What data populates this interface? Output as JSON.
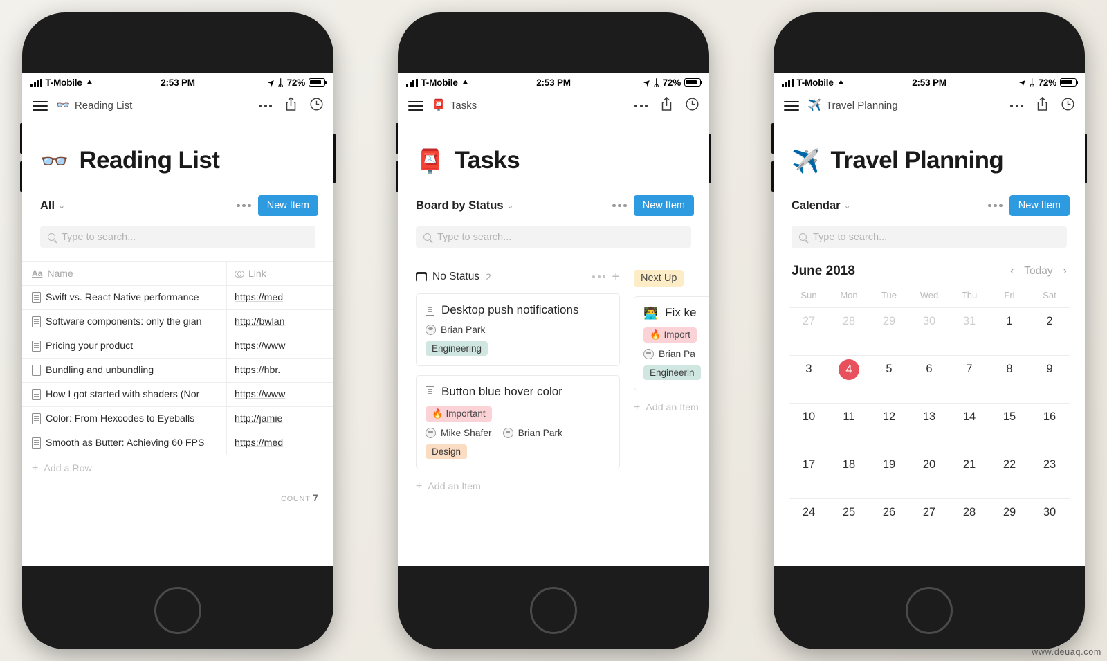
{
  "statusbar": {
    "carrier": "T-Mobile",
    "wifi_icon": "wifi-icon",
    "time": "2:53 PM",
    "location_icon": "location-arrow-icon",
    "bluetooth_icon": "bluetooth-icon",
    "battery": "72%"
  },
  "common": {
    "search_placeholder": "Type to search...",
    "new_item_label": "New Item",
    "menu_icon": "hamburger-menu-icon",
    "more_icon": "ellipsis-icon",
    "share_icon": "share-icon",
    "history_icon": "clock-history-icon",
    "accent_blue": "#2e9ae0",
    "accent_red": "#e8505b"
  },
  "phones": [
    {
      "nav": {
        "emoji": "👓",
        "title": "Reading List"
      },
      "page": {
        "emoji": "👓",
        "title": "Reading List"
      },
      "view": {
        "name": "All",
        "chevron": "⌄"
      },
      "table": {
        "columns": [
          {
            "label": "Name",
            "icon": "aa-text-icon"
          },
          {
            "label": "Link",
            "icon": "link-icon"
          }
        ],
        "rows": [
          {
            "name": "Swift vs. React Native performance",
            "link": "https://med"
          },
          {
            "name": "Software components: only the gian",
            "link": "http://bwlan"
          },
          {
            "name": "Pricing your product",
            "link": "https://www"
          },
          {
            "name": "Bundling and unbundling",
            "link": "https://hbr."
          },
          {
            "name": "How I got started with shaders (Nor",
            "link": "https://www"
          },
          {
            "name": "Color: From Hexcodes to Eyeballs",
            "link": "http://jamie"
          },
          {
            "name": "Smooth as Butter: Achieving 60 FPS",
            "link": "https://med"
          }
        ],
        "add_row_label": "Add a Row",
        "count_label": "COUNT",
        "count_value": "7"
      }
    },
    {
      "nav": {
        "emoji": "📮",
        "title": "Tasks"
      },
      "page": {
        "emoji": "📮",
        "title": "Tasks"
      },
      "view": {
        "name": "Board by Status",
        "chevron": "⌄"
      },
      "board": {
        "add_item_label": "Add an Item",
        "columns": [
          {
            "title": "No Status",
            "icon": "inbox-icon",
            "style": "plain",
            "count": "2",
            "cards": [
              {
                "emoji": "",
                "doc_icon": "document-icon",
                "title": "Desktop push notifications",
                "tags_top": [],
                "people": [
                  "Brian Park"
                ],
                "tags_bottom": [
                  {
                    "label": "Engineering",
                    "color": "eng"
                  }
                ]
              },
              {
                "emoji": "",
                "doc_icon": "document-icon",
                "title": "Button blue hover color",
                "tags_top": [
                  {
                    "label": "🔥 Important",
                    "color": "important"
                  }
                ],
                "people": [
                  "Mike Shafer",
                  "Brian Park"
                ],
                "tags_bottom": [
                  {
                    "label": "Design",
                    "color": "design"
                  }
                ]
              }
            ]
          },
          {
            "title": "Next Up",
            "icon": "",
            "style": "pill",
            "count": "",
            "cards": [
              {
                "emoji": "👨‍💻",
                "doc_icon": "",
                "title": "Fix ke",
                "tags_top": [
                  {
                    "label": "🔥 Import",
                    "color": "important"
                  }
                ],
                "people": [
                  "Brian Pa"
                ],
                "tags_bottom": [
                  {
                    "label": "Engineerin",
                    "color": "eng"
                  }
                ]
              }
            ]
          }
        ]
      }
    },
    {
      "nav": {
        "emoji": "✈️",
        "title": "Travel Planning"
      },
      "page": {
        "emoji": "✈️",
        "title": "Travel Planning"
      },
      "view": {
        "name": "Calendar",
        "chevron": "⌄"
      },
      "calendar": {
        "month": "June 2018",
        "prev_label": "‹",
        "today_label": "Today",
        "next_label": "›",
        "dow": [
          "Sun",
          "Mon",
          "Tue",
          "Wed",
          "Thu",
          "Fri",
          "Sat"
        ],
        "weeks": [
          [
            {
              "d": "27",
              "muted": true
            },
            {
              "d": "28",
              "muted": true
            },
            {
              "d": "29",
              "muted": true
            },
            {
              "d": "30",
              "muted": true
            },
            {
              "d": "31",
              "muted": true
            },
            {
              "d": "1",
              "muted": false
            },
            {
              "d": "2",
              "muted": false
            }
          ],
          [
            {
              "d": "3",
              "muted": false
            },
            {
              "d": "4",
              "muted": false,
              "today": true
            },
            {
              "d": "5",
              "muted": false
            },
            {
              "d": "6",
              "muted": false
            },
            {
              "d": "7",
              "muted": false
            },
            {
              "d": "8",
              "muted": false
            },
            {
              "d": "9",
              "muted": false
            }
          ],
          [
            {
              "d": "10",
              "muted": false
            },
            {
              "d": "11",
              "muted": false
            },
            {
              "d": "12",
              "muted": false
            },
            {
              "d": "13",
              "muted": false
            },
            {
              "d": "14",
              "muted": false
            },
            {
              "d": "15",
              "muted": false
            },
            {
              "d": "16",
              "muted": false
            }
          ],
          [
            {
              "d": "17",
              "muted": false
            },
            {
              "d": "18",
              "muted": false
            },
            {
              "d": "19",
              "muted": false
            },
            {
              "d": "20",
              "muted": false
            },
            {
              "d": "21",
              "muted": false
            },
            {
              "d": "22",
              "muted": false
            },
            {
              "d": "23",
              "muted": false
            }
          ],
          [
            {
              "d": "24",
              "muted": false
            },
            {
              "d": "25",
              "muted": false
            },
            {
              "d": "26",
              "muted": false
            },
            {
              "d": "27",
              "muted": false
            },
            {
              "d": "28",
              "muted": false
            },
            {
              "d": "29",
              "muted": false
            },
            {
              "d": "30",
              "muted": false
            }
          ]
        ]
      }
    }
  ],
  "watermark": "www.deuaq.com"
}
